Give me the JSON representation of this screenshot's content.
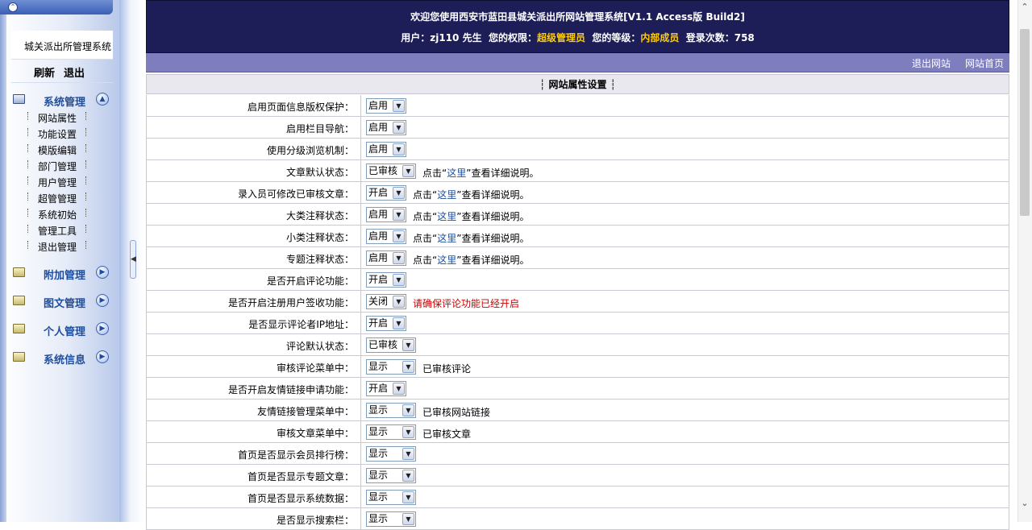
{
  "sidebar": {
    "site_title": "城关派出所管理系统",
    "refresh": "刷新",
    "logout": "退出",
    "groups": [
      {
        "label": "系统管理",
        "items": [
          "网站属性",
          "功能设置",
          "模版编辑",
          "部门管理",
          "用户管理",
          "超管管理",
          "系统初始",
          "管理工具",
          "退出管理"
        ]
      },
      {
        "label": "附加管理"
      },
      {
        "label": "图文管理"
      },
      {
        "label": "个人管理"
      },
      {
        "label": "系统信息"
      }
    ]
  },
  "header": {
    "title": "欢迎您使用西安市蓝田县城关派出所网站管理系统[V1.1 Access版 Build2]",
    "user_prefix": "用户：",
    "user": "zj110",
    "user_suffix": "先生",
    "perm_prefix": "您的权限：",
    "permission": "超级管理员",
    "level_prefix": "您的等级：",
    "level": "内部成员",
    "login_prefix": "登录次数：",
    "login_count": "758"
  },
  "toolbar": {
    "exit_site": "退出网站",
    "home": "网站首页"
  },
  "settings": {
    "title": "┆ 网站属性设置 ┆",
    "rows": [
      {
        "label": "启用页面信息版权保护：",
        "value": "启用",
        "note": ""
      },
      {
        "label": "启用栏目导航：",
        "value": "启用",
        "note": ""
      },
      {
        "label": "使用分级浏览机制：",
        "value": "启用",
        "note": ""
      },
      {
        "label": "文章默认状态：",
        "value": "已审核",
        "note_pre": "点击“",
        "note_link": "这里",
        "note_post": "”查看详细说明。"
      },
      {
        "label": "录入员可修改已审核文章：",
        "value": "开启",
        "note_pre": "点击“",
        "note_link": "这里",
        "note_post": "”查看详细说明。"
      },
      {
        "label": "大类注释状态：",
        "value": "启用",
        "note_pre": "点击“",
        "note_link": "这里",
        "note_post": "”查看详细说明。"
      },
      {
        "label": "小类注释状态：",
        "value": "启用",
        "note_pre": "点击“",
        "note_link": "这里",
        "note_post": "”查看详细说明。"
      },
      {
        "label": "专题注释状态：",
        "value": "启用",
        "note_pre": "点击“",
        "note_link": "这里",
        "note_post": "”查看详细说明。"
      },
      {
        "label": "是否开启评论功能：",
        "value": "开启",
        "note": ""
      },
      {
        "label": "是否开启注册用户签收功能：",
        "value": "关闭",
        "note_red": "请确保评论功能已经开启"
      },
      {
        "label": "是否显示评论者IP地址：",
        "value": "开启",
        "note": ""
      },
      {
        "label": "评论默认状态：",
        "value": "已审核",
        "note": ""
      },
      {
        "label": "审核评论菜单中：",
        "value": "显示",
        "note_plain": "已审核评论"
      },
      {
        "label": "是否开启友情链接申请功能：",
        "value": "开启",
        "note": ""
      },
      {
        "label": "友情链接管理菜单中：",
        "value": "显示",
        "note_plain": "已审核网站链接"
      },
      {
        "label": "审核文章菜单中：",
        "value": "显示",
        "note_plain": "已审核文章"
      },
      {
        "label": "首页是否显示会员排行榜：",
        "value": "显示",
        "note": ""
      },
      {
        "label": "首页是否显示专题文章：",
        "value": "显示",
        "note": ""
      },
      {
        "label": "首页是否显示系统数据：",
        "value": "显示",
        "note": ""
      },
      {
        "label": "是否显示搜索栏：",
        "value": "显示",
        "note": ""
      }
    ]
  },
  "colors": {
    "header_bg": "#1d1d57",
    "highlight": "#ffcc00",
    "toolbar_bg": "#7e7ebf",
    "link": "#1f4e9c",
    "warning": "#cc0000"
  }
}
